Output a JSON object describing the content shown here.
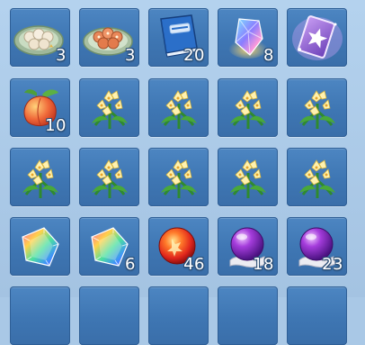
{
  "inventory": {
    "slots": [
      {
        "icon": "dumpling-plate-icon",
        "count": "3"
      },
      {
        "icon": "pastry-plate-icon",
        "count": "3"
      },
      {
        "icon": "blue-book-icon",
        "count": "20"
      },
      {
        "icon": "rainbow-crystal-icon",
        "count": "8"
      },
      {
        "icon": "purple-star-card-icon",
        "count": ""
      },
      {
        "icon": "peach-icon",
        "count": "10"
      },
      {
        "icon": "lily-flower-icon",
        "count": ""
      },
      {
        "icon": "lily-flower-icon",
        "count": ""
      },
      {
        "icon": "lily-flower-icon",
        "count": ""
      },
      {
        "icon": "lily-flower-icon",
        "count": ""
      },
      {
        "icon": "lily-flower-icon",
        "count": ""
      },
      {
        "icon": "lily-flower-icon",
        "count": ""
      },
      {
        "icon": "lily-flower-icon",
        "count": ""
      },
      {
        "icon": "lily-flower-icon",
        "count": ""
      },
      {
        "icon": "lily-flower-icon",
        "count": ""
      },
      {
        "icon": "rainbow-gem-icon",
        "count": ""
      },
      {
        "icon": "rainbow-gem-icon",
        "count": "6"
      },
      {
        "icon": "red-orb-icon",
        "count": "46"
      },
      {
        "icon": "purple-orb-icon",
        "count": "18"
      },
      {
        "icon": "purple-orb-icon",
        "count": "23"
      }
    ]
  }
}
